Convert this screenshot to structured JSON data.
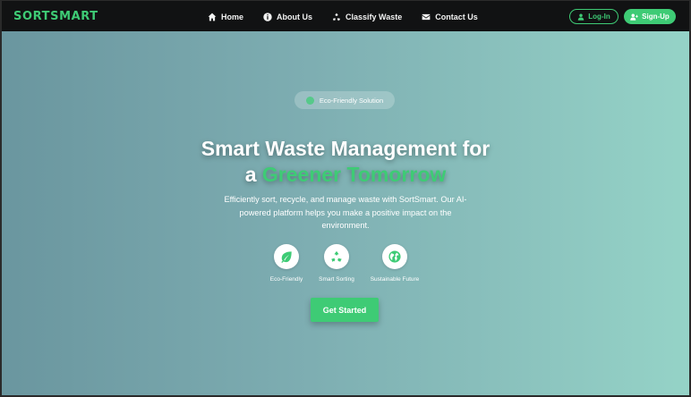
{
  "brand": {
    "name": "SORTSMART",
    "accent": "#3ecb75"
  },
  "nav": {
    "items": [
      {
        "label": "Home",
        "icon": "home-icon"
      },
      {
        "label": "About Us",
        "icon": "info-icon"
      },
      {
        "label": "Classify Waste",
        "icon": "recycle-icon"
      },
      {
        "label": "Contact Us",
        "icon": "envelope-icon"
      }
    ],
    "login_label": "Log-In",
    "signup_label": "Sign-Up"
  },
  "hero": {
    "badge": "Eco-Friendly Solution",
    "headline_line1": "Smart Waste Management for",
    "headline_prefix": "a",
    "headline_highlight": "Greener Tomorrow",
    "description": "Efficiently sort, recycle, and manage waste with SortSmart. Our AI-powered platform helps you make a positive impact on the environment.",
    "features": [
      {
        "label": "Eco-Friendly",
        "icon": "leaf-icon"
      },
      {
        "label": "Smart Sorting",
        "icon": "recycle-icon"
      },
      {
        "label": "Sustainable Future",
        "icon": "globe-icon"
      }
    ],
    "cta_label": "Get Started"
  }
}
